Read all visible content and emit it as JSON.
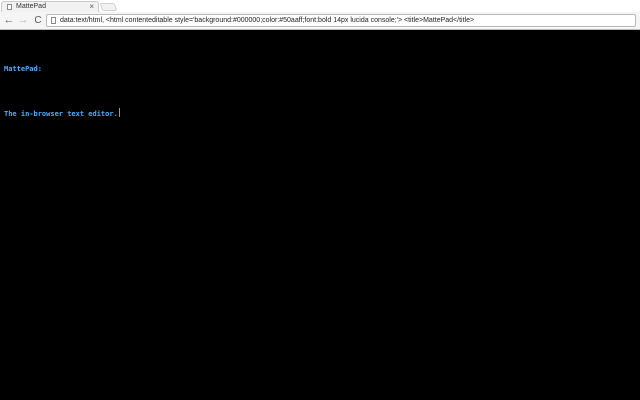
{
  "browser": {
    "tab": {
      "title": "MattePad",
      "close_glyph": "×",
      "favicon": "page-icon"
    },
    "toolbar": {
      "back_glyph": "←",
      "forward_glyph": "→",
      "reload_glyph": "C",
      "url": "data:text/html, <html contenteditable style='background:#000000;color:#50aaff;font:bold 14px lucida console;'> <title>MattePad</title>"
    }
  },
  "editor": {
    "line1": "MattePad:",
    "line2": "The in-browser text editor."
  },
  "colors": {
    "background": "#000000",
    "text": "#50aaff"
  }
}
